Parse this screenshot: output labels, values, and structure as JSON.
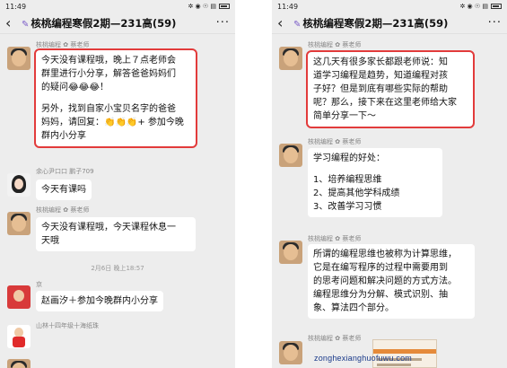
{
  "left": {
    "status_time": "11:49",
    "status_icons": "✲ ◉ ☉ ▤",
    "title": "核桃编程寒假2期—231高(59)",
    "messages": [
      {
        "sender": "核桃编程 ✿ 蔡老师",
        "lines": [
          "今天没有课程哦，晚上７点老师会",
          "群里进行小分享，解答爸爸妈妈们",
          "的疑问😂😂😂！",
          "",
          "另外，找到自家小宝贝名字的爸爸",
          "妈妈，请回复：👏👏👏+ 参加今晚",
          "群内小分享"
        ]
      },
      {
        "sender": "余心尹口口 鹏子709",
        "lines": [
          "今天有课吗"
        ]
      },
      {
        "sender": "核桃编程 ✿ 蔡老师",
        "lines": [
          "今天没有课程哦，今天课程休息一",
          "天哦"
        ]
      },
      {
        "sender": "京",
        "lines": [
          "赵画汐＋参加今晚群内小分享"
        ]
      },
      {
        "sender": "山林十四年级十海纸珠",
        "lines": []
      }
    ],
    "time_divider": "2月6日 晚上18:57"
  },
  "right": {
    "status_time": "11:49",
    "status_icons": "✲ ◉ ☉ ▤",
    "title": "核桃编程寒假2期—231高(59)",
    "messages": [
      {
        "sender": "核桃编程 ✿ 蔡老师",
        "lines": [
          "这几天有很多家长都跟老师说：知",
          "道学习编程是趋势，知道编程对孩",
          "子好？但是到底有哪些实际的帮助",
          "呢？那么，接下来在这里老师给大家",
          "简单分享一下～"
        ]
      },
      {
        "sender": "核桃编程 ✿ 蔡老师",
        "lines": [
          "学习编程的好处：",
          "",
          "1、培养编程思维",
          "2、提高其他学科成绩",
          "3、改善学习习惯"
        ]
      },
      {
        "sender": "核桃编程 ✿ 蔡老师",
        "lines": [
          "所谓的编程思维也被称为计算思维，",
          "它是在编写程序的过程中需要用到",
          "的思考问题和解决问题的方式方法。",
          "编程思维分为分解、模式识别、抽",
          "象、算法四个部分。"
        ]
      },
      {
        "sender": "核桃编程 ✿ 蔡老师",
        "lines": []
      }
    ]
  },
  "watermark": "zonghexianghuofuwu.com",
  "colors": {
    "highlight_box": "#e23b3b",
    "chat_bg": "#ededed",
    "bubble_bg": "#ffffff"
  }
}
